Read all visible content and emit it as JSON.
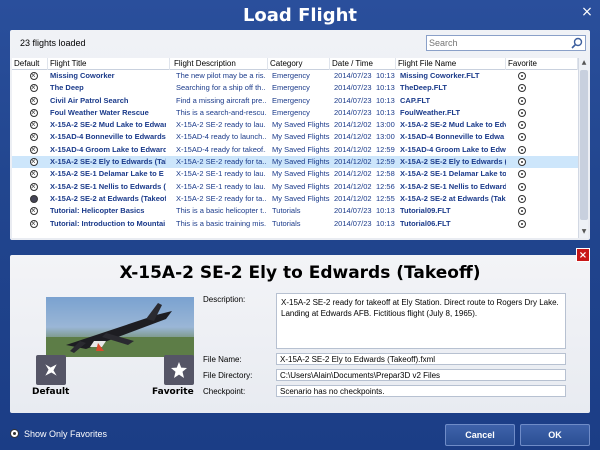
{
  "window": {
    "title": "Load Flight",
    "close_glyph": "×"
  },
  "toolbar": {
    "loaded_label": "23 flights loaded",
    "search_placeholder": "Search"
  },
  "table": {
    "columns": [
      "Default",
      "Flight Title",
      "Flight Description",
      "Category",
      "Date / Time",
      "Flight File Name",
      "Favorite"
    ],
    "rows": [
      {
        "def": "x",
        "title": "Missing Coworker",
        "desc": "The new pilot may be a ris...",
        "category": "Emergency",
        "date": "2014/07/23",
        "time": "10:13",
        "file": "Missing Coworker.FLT",
        "fav": "dot"
      },
      {
        "def": "x",
        "title": "The Deep",
        "desc": "Searching for a ship off th...",
        "category": "Emergency",
        "date": "2014/07/23",
        "time": "10:13",
        "file": "TheDeep.FLT",
        "fav": "dot"
      },
      {
        "def": "x",
        "title": "Civil Air Patrol Search",
        "desc": "Find a missing aircraft pre...",
        "category": "Emergency",
        "date": "2014/07/23",
        "time": "10:13",
        "file": "CAP.FLT",
        "fav": "dot"
      },
      {
        "def": "x",
        "title": "Foul Weather Water Rescue",
        "desc": "This is a search-and-rescu...",
        "category": "Emergency",
        "date": "2014/07/23",
        "time": "10:13",
        "file": "FoulWeather.FLT",
        "fav": "dot"
      },
      {
        "def": "x",
        "title": "X-15A-2 SE-2 Mud Lake to Edwar",
        "desc": "X-15A-2 SE-2 ready to lau...",
        "category": "My Saved Flights",
        "date": "2014/12/02",
        "time": "13:00",
        "file": "X-15A-2 SE-2 Mud Lake to Edv",
        "fav": "dot"
      },
      {
        "def": "x",
        "title": "X-15AD-4 Bonneville to Edwards",
        "desc": "X-15AD-4 ready to launch...",
        "category": "My Saved Flights",
        "date": "2014/12/02",
        "time": "13:00",
        "file": "X-15AD-4 Bonneville to Edwa",
        "fav": "dot"
      },
      {
        "def": "x",
        "title": "X-15AD-4 Groom Lake to Edward",
        "desc": "X-15AD-4 ready for takeof...",
        "category": "My Saved Flights",
        "date": "2014/12/02",
        "time": "12:59",
        "file": "X-15AD-4 Groom Lake to Edw",
        "fav": "dot"
      },
      {
        "def": "x",
        "title": "X-15A-2 SE-2 Ely to Edwards (Tak",
        "desc": "X-15A-2 SE-2 ready for ta...",
        "category": "My Saved Flights",
        "date": "2014/12/02",
        "time": "12:59",
        "file": "X-15A-2 SE-2 Ely to Edwards (",
        "fav": "dot",
        "selected": true
      },
      {
        "def": "x",
        "title": "X-15A-2 SE-1 Delamar Lake to E",
        "desc": "X-15A-2 SE-1 ready to lau...",
        "category": "My Saved Flights",
        "date": "2014/12/02",
        "time": "12:58",
        "file": "X-15A-2 SE-1 Delamar Lake to",
        "fav": "dot"
      },
      {
        "def": "x",
        "title": "X-15A-2 SE-1 Nellis to Edwards (T",
        "desc": "X-15A-2 SE-1 ready to lau...",
        "category": "My Saved Flights",
        "date": "2014/12/02",
        "time": "12:56",
        "file": "X-15A-2 SE-1 Nellis to Edward",
        "fav": "dot"
      },
      {
        "def": "full",
        "title": "X-15A-2 SE-2 at Edwards (Takeoff",
        "desc": "X-15A-2 SE-2 ready for ta...",
        "category": "My Saved Flights",
        "date": "2014/12/02",
        "time": "12:55",
        "file": "X-15A-2 SE-2 at Edwards (Tak",
        "fav": "dot"
      },
      {
        "def": "x",
        "title": "Tutorial: Helicopter Basics",
        "desc": "This is a basic helicopter t...",
        "category": "Tutorials",
        "date": "2014/07/23",
        "time": "10:13",
        "file": "Tutorial09.FLT",
        "fav": "dot"
      },
      {
        "def": "x",
        "title": "Tutorial: Introduction to Mountai",
        "desc": "This is a basic training mis...",
        "category": "Tutorials",
        "date": "2014/07/23",
        "time": "10:13",
        "file": "Tutorial06.FLT",
        "fav": "dot"
      }
    ]
  },
  "detail": {
    "title": "X-15A-2 SE-2 Ely to Edwards (Takeoff)",
    "description_label": "Description:",
    "description": "X-15A-2 SE-2 ready for takeoff at Ely Station. Direct route to Rogers Dry Lake. Landing at Edwards AFB. Fictitious flight (July 8, 1965).",
    "file_name_label": "File Name:",
    "file_name": "X-15A-2 SE-2 Ely to Edwards (Takeoff).fxml",
    "file_directory_label": "File Directory:",
    "file_directory": "C:\\Users\\Alain\\Documents\\Prepar3D v2 Files",
    "checkpoint_label": "Checkpoint:",
    "checkpoint": "Scenario has no checkpoints.",
    "default_label": "Default",
    "favorite_label": "Favorite",
    "close_glyph": "×"
  },
  "footer": {
    "favorites_label": "Show Only Favorites",
    "cancel_label": "Cancel",
    "ok_label": "OK"
  }
}
